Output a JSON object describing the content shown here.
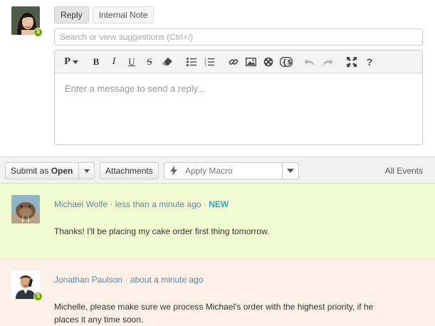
{
  "composer": {
    "tabs": [
      {
        "label": "Reply",
        "active": true
      },
      {
        "label": "Internal Note",
        "active": false
      }
    ],
    "search": {
      "placeholder": "Search or view suggestions (Ctrl+/)",
      "value": ""
    },
    "toolbar": {
      "paragraph_label": "P",
      "buttons": [
        "bold-icon",
        "italic-icon",
        "underline-icon",
        "strikethrough-icon",
        "eraser-icon",
        "bullet-list-icon",
        "numbered-list-icon",
        "link-icon",
        "image-icon",
        "film-icon",
        "code-braces-icon",
        "undo-icon",
        "redo-icon",
        "fullscreen-icon",
        "help-icon"
      ],
      "bold_label": "B",
      "italic_label": "I",
      "underline_label": "U",
      "strike_label": "S",
      "help_label": "?"
    },
    "message": {
      "placeholder": "Enter a message to send a reply...",
      "value": ""
    },
    "agent_badge": "S"
  },
  "actions": {
    "submit_prefix": "Submit as",
    "submit_status": "Open",
    "attachments_label": "Attachments",
    "macro_placeholder": "Apply Macro",
    "all_events_label": "All Events"
  },
  "events": [
    {
      "author": "Michael Wolfe",
      "time": "less than a minute ago",
      "tag": "NEW",
      "body": "Thanks! I'll be placing my cake order first thing tomorrow.",
      "background": "#f3fcd1"
    },
    {
      "author": "Jonathan Paulson",
      "time": "about a minute ago",
      "badge": "S",
      "body": "Michelle, please make sure we process Michael's order with the highest priority, if he places it any time soon.",
      "background": "#fdf1e7"
    }
  ],
  "colors": {
    "accent": "#78a300",
    "link": "#5c86a6",
    "new_tag": "#3a9fc7"
  }
}
